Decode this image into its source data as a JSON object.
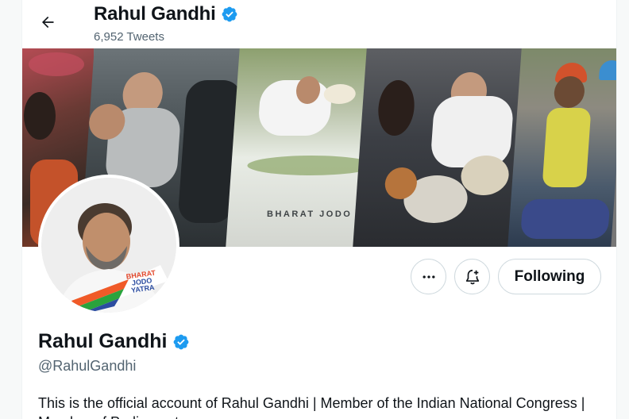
{
  "header": {
    "back_icon": "arrow-left-icon",
    "name": "Rahul Gandhi",
    "tweet_count": "6,952 Tweets"
  },
  "banner": {
    "caption": "BHARAT JODO"
  },
  "avatar": {
    "badge_text": [
      "BHARAT",
      "JODO",
      "YATRA"
    ]
  },
  "actions": {
    "more_icon": "more-horizontal-icon",
    "notify_icon": "bell-plus-icon",
    "follow_label": "Following"
  },
  "profile": {
    "name": "Rahul Gandhi",
    "handle": "@RahulGandhi",
    "bio": "This is the official account of Rahul Gandhi | Member of the Indian National Congress | Member of Parliament"
  },
  "colors": {
    "verified_blue": "#1d9bf0",
    "text_primary": "#0f1419",
    "text_secondary": "#536471",
    "border": "#cfd9de"
  }
}
